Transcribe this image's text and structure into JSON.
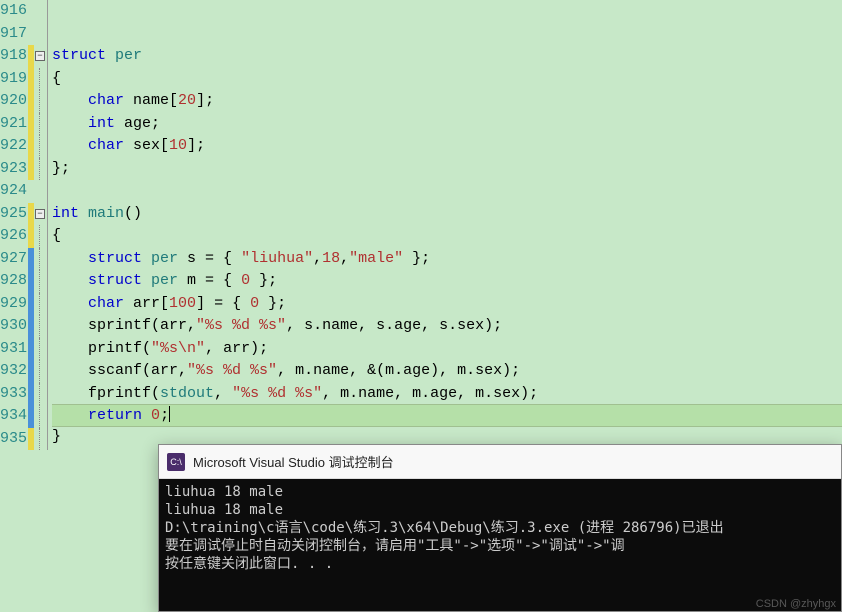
{
  "lineNumbers": [
    "916",
    "917",
    "918",
    "919",
    "920",
    "921",
    "922",
    "923",
    "924",
    "925",
    "926",
    "927",
    "928",
    "929",
    "930",
    "931",
    "932",
    "933",
    "934",
    "935"
  ],
  "changeBars": [
    "",
    "",
    "yellow",
    "yellow",
    "yellow",
    "yellow",
    "yellow",
    "yellow",
    "",
    "yellow",
    "yellow",
    "blue",
    "blue",
    "blue",
    "blue",
    "blue",
    "blue",
    "blue",
    "blue",
    "yellow"
  ],
  "fold": {
    "918": true,
    "925": true
  },
  "code": {
    "l916": "",
    "l917": "",
    "l918_kw": "struct",
    "l918_type": " per",
    "l919": "{",
    "l920_kw": "char",
    "l920_rest": " name[",
    "l920_num": "20",
    "l920_end": "];",
    "l921_kw": "int",
    "l921_rest": " age;",
    "l922_kw": "char",
    "l922_rest": " sex[",
    "l922_num": "10",
    "l922_end": "];",
    "l923": "};",
    "l924": "",
    "l925_kw": "int",
    "l925_func": " main",
    "l925_rest": "()",
    "l926": "{",
    "l927_kw": "struct",
    "l927_type": " per",
    "l927_rest1": " s = { ",
    "l927_str": "\"liuhua\"",
    "l927_rest2": ",",
    "l927_num1": "18",
    "l927_rest3": ",",
    "l927_str2": "\"male\"",
    "l927_rest4": " };",
    "l928_kw": "struct",
    "l928_type": " per",
    "l928_rest1": " m = { ",
    "l928_num": "0",
    "l928_rest2": " };",
    "l929_kw": "char",
    "l929_rest1": " arr[",
    "l929_num1": "100",
    "l929_rest2": "] = { ",
    "l929_num2": "0",
    "l929_rest3": " };",
    "l930_func": "sprintf",
    "l930_rest1": "(arr,",
    "l930_str": "\"%s %d %s\"",
    "l930_rest2": ", s.name, s.age, s.sex);",
    "l931_func": "printf",
    "l931_rest1": "(",
    "l931_str": "\"%s\\n\"",
    "l931_rest2": ", arr);",
    "l932_func": "sscanf",
    "l932_rest1": "(arr,",
    "l932_str": "\"%s %d %s\"",
    "l932_rest2": ", m.name, &(m.age), m.sex);",
    "l933_func": "fprintf",
    "l933_rest1": "(",
    "l933_stdio": "stdout",
    "l933_rest2": ", ",
    "l933_str": "\"%s %d %s\"",
    "l933_rest3": ", m.name, m.age, m.sex);",
    "l934_kw": "return",
    "l934_rest1": " ",
    "l934_num": "0",
    "l934_rest2": ";",
    "l935": "}"
  },
  "console": {
    "title": "Microsoft Visual Studio 调试控制台",
    "icon": "C:\\",
    "lines": [
      "liuhua 18 male",
      "liuhua 18 male",
      "D:\\training\\c语言\\code\\练习.3\\x64\\Debug\\练习.3.exe (进程 286796)已退出",
      "要在调试停止时自动关闭控制台，请启用\"工具\"->\"选项\"->\"调试\"->\"调",
      "按任意键关闭此窗口. . ."
    ]
  },
  "watermark": "CSDN @zhyhgx"
}
